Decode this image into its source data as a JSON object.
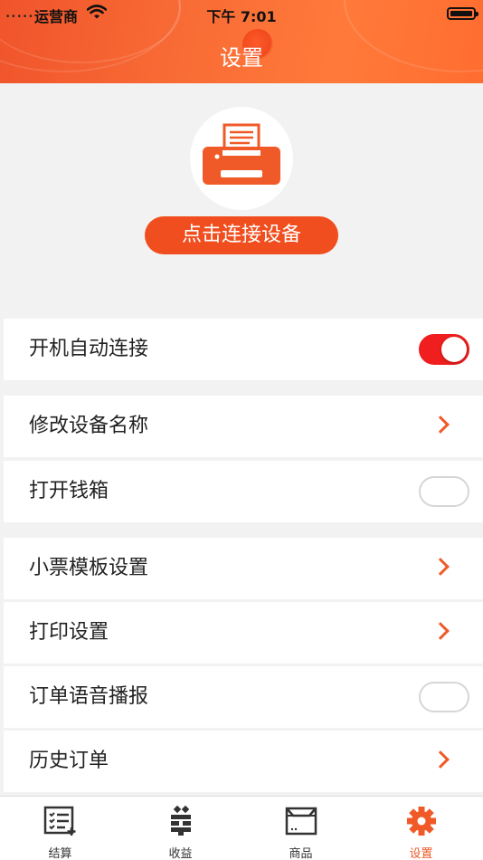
{
  "status_bar": {
    "carrier": "运营商",
    "time": "下午 7:01"
  },
  "header": {
    "title": "设置"
  },
  "device": {
    "icon": "printer-icon",
    "connect_button": "点击连接设备"
  },
  "settings": [
    {
      "label": "开机自动连接",
      "control": "toggle",
      "state": "on"
    },
    {
      "label": "修改设备名称",
      "control": "chevron"
    },
    {
      "label": "打开钱箱",
      "control": "toggle",
      "state": "off"
    },
    {
      "label": "小票模板设置",
      "control": "chevron"
    },
    {
      "label": "打印设置",
      "control": "chevron"
    },
    {
      "label": "订单语音播报",
      "control": "toggle",
      "state": "off"
    },
    {
      "label": "历史订单",
      "control": "chevron"
    }
  ],
  "tabbar": {
    "tabs": [
      {
        "label": "结算",
        "icon": "checklist-icon"
      },
      {
        "label": "收益",
        "icon": "money-icon"
      },
      {
        "label": "商品",
        "icon": "box-icon"
      },
      {
        "label": "设置",
        "icon": "gear-icon",
        "active": true
      }
    ]
  },
  "colors": {
    "accent": "#f05a28",
    "header": "#ff6d2f",
    "toggle_on": "#f01e1e"
  }
}
